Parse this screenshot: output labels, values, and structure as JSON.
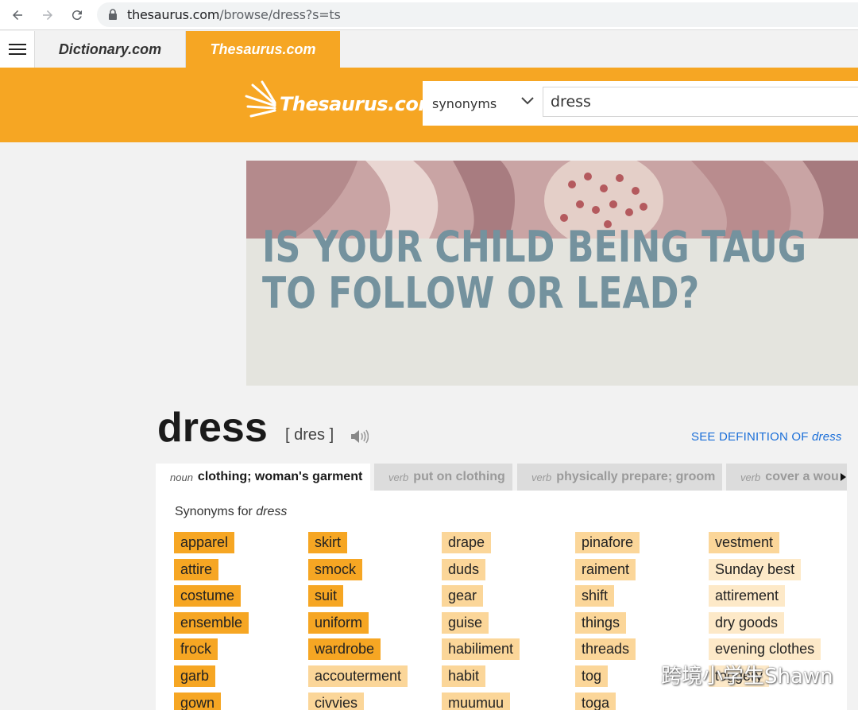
{
  "browser": {
    "url_host": "thesaurus.com",
    "url_rest": "/browse/dress?s=ts"
  },
  "site_tabs": {
    "dictionary": "Dictionary.com",
    "thesaurus": "Thesaurus.com"
  },
  "header": {
    "logo_text": "Thesaurus.com",
    "search_type": "synonyms",
    "search_value": "dress"
  },
  "ad": {
    "line1": "IS YOUR CHILD BEING TAUG",
    "line2": "TO FOLLOW OR LEAD?"
  },
  "entry": {
    "word": "dress",
    "pronunciation": "[ dres ]",
    "see_definition_label": "SEE DEFINITION OF",
    "see_definition_word": "dress"
  },
  "senses": [
    {
      "pos": "noun",
      "label": "clothing; woman's garment"
    },
    {
      "pos": "verb",
      "label": "put on clothing"
    },
    {
      "pos": "verb",
      "label": "physically prepare; groom"
    },
    {
      "pos": "verb",
      "label": "cover a wou"
    }
  ],
  "synonyms_heading": {
    "prefix": "Synonyms for",
    "word": "dress"
  },
  "synonym_columns": [
    [
      {
        "word": "apparel",
        "level": 3
      },
      {
        "word": "attire",
        "level": 3
      },
      {
        "word": "costume",
        "level": 3
      },
      {
        "word": "ensemble",
        "level": 3
      },
      {
        "word": "frock",
        "level": 3
      },
      {
        "word": "garb",
        "level": 3
      },
      {
        "word": "gown",
        "level": 3
      }
    ],
    [
      {
        "word": "skirt",
        "level": 3
      },
      {
        "word": "smock",
        "level": 3
      },
      {
        "word": "suit",
        "level": 3
      },
      {
        "word": "uniform",
        "level": 3
      },
      {
        "word": "wardrobe",
        "level": 3
      },
      {
        "word": "accouterment",
        "level": 2
      },
      {
        "word": "civvies",
        "level": 2
      }
    ],
    [
      {
        "word": "drape",
        "level": 2
      },
      {
        "word": "duds",
        "level": 2
      },
      {
        "word": "gear",
        "level": 2
      },
      {
        "word": "guise",
        "level": 2
      },
      {
        "word": "habiliment",
        "level": 2
      },
      {
        "word": "habit",
        "level": 2
      },
      {
        "word": "muumuu",
        "level": 2
      }
    ],
    [
      {
        "word": "pinafore",
        "level": 2
      },
      {
        "word": "raiment",
        "level": 2
      },
      {
        "word": "shift",
        "level": 2
      },
      {
        "word": "things",
        "level": 2
      },
      {
        "word": "threads",
        "level": 2
      },
      {
        "word": "tog",
        "level": 2
      },
      {
        "word": "toga",
        "level": 2
      }
    ],
    [
      {
        "word": "vestment",
        "level": 2
      },
      {
        "word": "Sunday best",
        "level": 1
      },
      {
        "word": "attirement",
        "level": 1
      },
      {
        "word": "dry goods",
        "level": 1
      },
      {
        "word": "evening clothes",
        "level": 1
      },
      {
        "word": "toggery",
        "level": 1
      }
    ]
  ],
  "watermark": {
    "text": "跨境小学生Shawn"
  },
  "colors": {
    "brand_orange": "#f6a623",
    "link_blue": "#1a6ed8",
    "relevance_high": "#f6a623",
    "relevance_mid": "#fbd699",
    "relevance_low": "#fde9c8"
  }
}
